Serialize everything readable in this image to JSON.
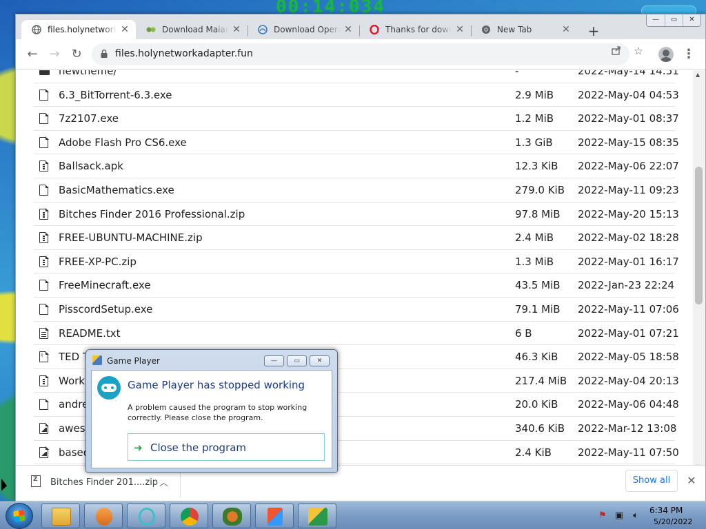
{
  "desktop": {
    "clock_overlay": "00:14:034"
  },
  "browser": {
    "tabs": [
      {
        "title": "files.holynetworkadapter.fun",
        "icon": "globe-icon",
        "active": true
      },
      {
        "title": "Download Maiar Browser",
        "icon": "maiar-icon",
        "active": false
      },
      {
        "title": "Download Opera Browser",
        "icon": "opera-gx-icon",
        "active": false
      },
      {
        "title": "Thanks for downloading",
        "icon": "opera-icon",
        "active": false
      },
      {
        "title": "New Tab",
        "icon": "chrome-icon",
        "active": false
      }
    ],
    "new_tab": "+",
    "window_controls": {
      "minimize": "—",
      "maximize": "▭",
      "close": "✕"
    },
    "url": "files.holynetworkadapter.fun"
  },
  "files": [
    {
      "name": "newtheme/",
      "size": "-",
      "date": "2022-May-14 14:51",
      "icon": "folder"
    },
    {
      "name": "6.3_BitTorrent-6.3.exe",
      "size": "2.9 MiB",
      "date": "2022-May-04 04:53",
      "icon": "file"
    },
    {
      "name": "7z2107.exe",
      "size": "1.2 MiB",
      "date": "2022-May-01 08:37",
      "icon": "file"
    },
    {
      "name": "Adobe Flash Pro CS6.exe",
      "size": "1.3 GiB",
      "date": "2022-May-15 08:35",
      "icon": "file"
    },
    {
      "name": "Ballsack.apk",
      "size": "12.3 KiB",
      "date": "2022-May-06 22:07",
      "icon": "zip"
    },
    {
      "name": "BasicMathematics.exe",
      "size": "279.0 KiB",
      "date": "2022-May-11 09:23",
      "icon": "file"
    },
    {
      "name": "Bitches Finder 2016 Professional.zip",
      "size": "97.8 MiB",
      "date": "2022-May-20 15:13",
      "icon": "zip"
    },
    {
      "name": "FREE-UBUNTU-MACHINE.zip",
      "size": "2.4 MiB",
      "date": "2022-May-02 18:28",
      "icon": "zip"
    },
    {
      "name": "FREE-XP-PC.zip",
      "size": "1.3 MiB",
      "date": "2022-May-01 16:17",
      "icon": "zip"
    },
    {
      "name": "FreeMinecraft.exe",
      "size": "43.5 MiB",
      "date": "2022-Jan-23 22:24",
      "icon": "file"
    },
    {
      "name": "PisscordSetup.exe",
      "size": "79.1 MiB",
      "date": "2022-May-11 07:06",
      "icon": "file"
    },
    {
      "name": "README.txt",
      "size": "6 B",
      "date": "2022-May-01 07:21",
      "icon": "txt"
    },
    {
      "name": "TED Ta",
      "size": "46.3 KiB",
      "date": "2022-May-05 18:58",
      "icon": "pdf"
    },
    {
      "name": "Workp",
      "size": "217.4 MiB",
      "date": "2022-May-04 20:13",
      "icon": "zip"
    },
    {
      "name": "andre",
      "size": "20.0 KiB",
      "date": "2022-May-06 04:48",
      "icon": "file"
    },
    {
      "name": "awesc",
      "size": "340.6 KiB",
      "date": "2022-Mar-12 13:08",
      "icon": "img"
    },
    {
      "name": "based",
      "size": "2.4 KiB",
      "date": "2022-May-11 07:50",
      "icon": "img"
    }
  ],
  "download_shelf": {
    "item_name": "Bitches Finder 201....zip",
    "show_all": "Show all",
    "close": "✕"
  },
  "dialog": {
    "title": "Game Player",
    "heading": "Game Player has stopped working",
    "message": "A problem caused the program to stop working correctly. Please close the program.",
    "action": "Close the program",
    "controls": {
      "minimize": "—",
      "maximize": "▭",
      "close": "✕"
    }
  },
  "taskbar": {
    "apps": [
      "file-explorer-icon",
      "media-player-icon",
      "opera-gx-icon",
      "chrome-icon",
      "maiar-icon",
      "office-icon",
      "game-player-icon"
    ],
    "time": "6:34 PM",
    "date": "5/20/2022"
  },
  "colors": {
    "link_blue": "#1a73e8",
    "dialog_heading": "#1a3c8c",
    "taskbar": "#7b9cc4"
  }
}
